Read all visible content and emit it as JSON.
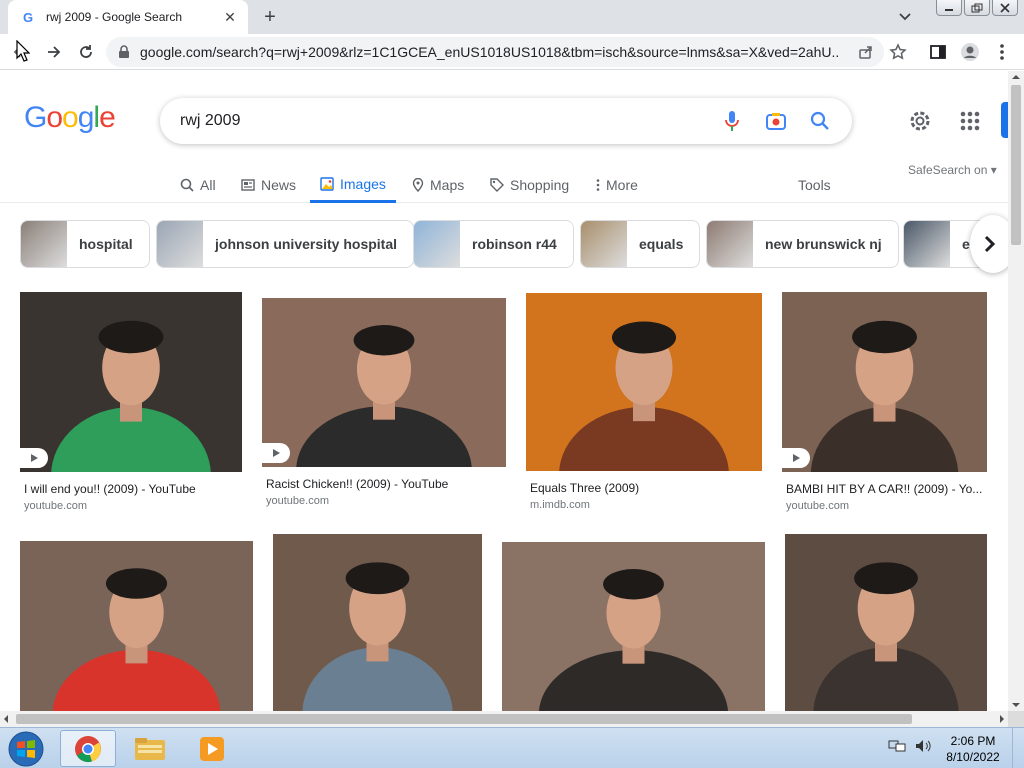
{
  "browser": {
    "tab_title": "rwj 2009 - Google Search",
    "favicon_letter": "G",
    "url": "google.com/search?q=rwj+2009&rlz=1C1GCEA_enUS1018US1018&tbm=isch&source=lnms&sa=X&ved=2ahU..."
  },
  "google": {
    "logo_letters": [
      "G",
      "o",
      "o",
      "g",
      "l",
      "e"
    ],
    "logo_colors": [
      "#4285f4",
      "#ea4335",
      "#fbbc05",
      "#4285f4",
      "#34a853",
      "#ea4335"
    ],
    "query": "rwj 2009",
    "safesearch": "SafeSearch on ▾",
    "tools_label": "Tools",
    "nav_tabs": [
      {
        "label": "All",
        "icon": "search-icon"
      },
      {
        "label": "News",
        "icon": "news-icon"
      },
      {
        "label": "Images",
        "icon": "images-icon",
        "active": true
      },
      {
        "label": "Maps",
        "icon": "map-pin-icon"
      },
      {
        "label": "Shopping",
        "icon": "tag-icon"
      },
      {
        "label": "More",
        "icon": "more-vert-icon"
      }
    ],
    "chips": [
      {
        "label": "hospital",
        "color": "#8a7f78"
      },
      {
        "label": "johnson university hospital",
        "color": "#9aa6b4"
      },
      {
        "label": "robinson r44",
        "color": "#8fb4d8"
      },
      {
        "label": "equals",
        "color": "#a88f6b"
      },
      {
        "label": "new brunswick nj",
        "color": "#8d7b72"
      },
      {
        "label": "e",
        "color": "#4a5868"
      }
    ],
    "results": [
      {
        "title": "I will end you!! (2009) - YouTube",
        "source": "youtube.com",
        "video": true,
        "bg": "#3a3430",
        "accent": "#2e9e5a"
      },
      {
        "title": "Racist Chicken!! (2009) - YouTube",
        "source": "youtube.com",
        "video": true,
        "bg": "#8a6a5a",
        "accent": "#2b2b2b"
      },
      {
        "title": "Equals Three (2009)",
        "source": "m.imdb.com",
        "video": false,
        "bg": "#d2731e",
        "accent": "#7a3a22"
      },
      {
        "title": "BAMBI HIT BY A CAR!! (2009) - Yo...",
        "source": "youtube.com",
        "video": true,
        "bg": "#7c6253",
        "accent": "#3b2f2a"
      },
      {
        "title": "",
        "source": "",
        "video": false,
        "bg": "#7a6458",
        "accent": "#d8342b"
      },
      {
        "title": "",
        "source": "",
        "video": false,
        "bg": "#6f5a4c",
        "accent": "#6b7f92"
      },
      {
        "title": "",
        "source": "",
        "video": false,
        "bg": "#8a7364",
        "accent": "#2e2a28"
      },
      {
        "title": "",
        "source": "",
        "video": false,
        "bg": "#5d4c42",
        "accent": "#3a3330"
      }
    ]
  },
  "taskbar": {
    "time": "2:06 PM",
    "date": "8/10/2022",
    "apps": [
      "chrome-icon",
      "file-explorer-icon",
      "media-player-icon"
    ]
  }
}
